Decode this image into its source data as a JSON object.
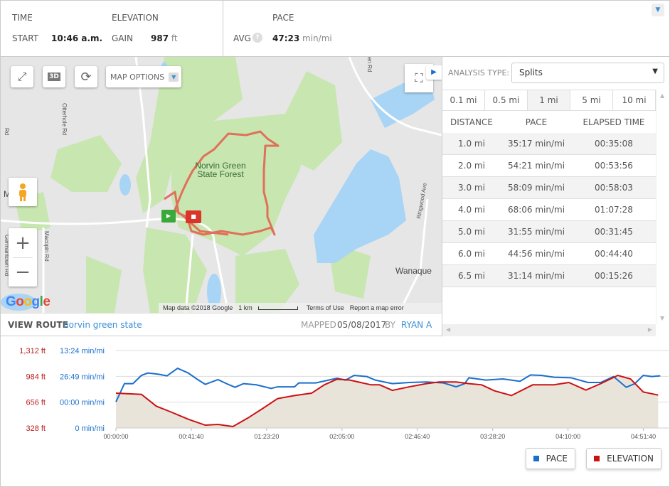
{
  "stats": {
    "time": {
      "heading": "TIME",
      "label": "START",
      "value": "10:46 a.m."
    },
    "elevation": {
      "heading": "ELEVATION",
      "label": "GAIN",
      "value": "987",
      "unit": "ft"
    },
    "pace": {
      "heading": "PACE",
      "label": "AVG",
      "help": "?",
      "value": "47:23",
      "unit": "min/mi"
    }
  },
  "map": {
    "options_label": "MAP OPTIONS",
    "btn_3d": "3D",
    "place_labels": {
      "forest_line1": "Norvin Green",
      "forest_line2": "State Forest",
      "town": "Wanaque",
      "town_left": "M       n"
    },
    "road_labels": {
      "otterhole": "Otterhole Rd",
      "macopin": "Macopin Rd",
      "ringwood": "Ringwood Ave",
      "germantown": "Germantown Rd",
      "top": "en Rd",
      "left": "Rd"
    },
    "logo": "Google",
    "attribution": "Map data ©2018 Google",
    "scale": "1 km",
    "terms": "Terms of Use",
    "report": "Report a map error",
    "colors": {
      "route": "#e0705a",
      "park": "#c8e6b0",
      "water": "#a8d4f5",
      "land": "#e8e8e8"
    }
  },
  "route": {
    "view_label": "VIEW ROUTE",
    "name": "norvin green state",
    "mapped_label": "MAPPED",
    "date": "05/08/2017",
    "by_label": "BY",
    "author": "RYAN A"
  },
  "analysis": {
    "type_label": "ANALYSIS TYPE:",
    "selected": "Splits",
    "tabs": [
      "0.1 mi",
      "0.5 mi",
      "1 mi",
      "5 mi",
      "10 mi"
    ],
    "active_tab": "1 mi",
    "columns": [
      "DISTANCE",
      "PACE",
      "ELAPSED TIME"
    ],
    "rows": [
      [
        "1.0 mi",
        "35:17 min/mi",
        "00:35:08"
      ],
      [
        "2.0 mi",
        "54:21 min/mi",
        "00:53:56"
      ],
      [
        "3.0 mi",
        "58:09 min/mi",
        "00:58:03"
      ],
      [
        "4.0 mi",
        "68:06 min/mi",
        "01:07:28"
      ],
      [
        "5.0 mi",
        "31:55 min/mi",
        "00:31:45"
      ],
      [
        "6.0 mi",
        "44:56 min/mi",
        "00:44:40"
      ],
      [
        "6.5 mi",
        "31:14 min/mi",
        "00:15:26"
      ]
    ]
  },
  "chart_data": {
    "type": "line",
    "x_unit": "elapsed seconds",
    "x_ticks": [
      "00:00:00",
      "00:41:40",
      "01:23:20",
      "02:05:00",
      "02:46:40",
      "03:28:20",
      "04:10:00",
      "04:51:40"
    ],
    "x_tick_values": [
      0,
      2500,
      5000,
      7500,
      10000,
      12500,
      15000,
      17500
    ],
    "xlim": [
      0,
      18100
    ],
    "y_left_elev_ticks": [
      "1,312 ft",
      "984 ft",
      "656 ft",
      "328 ft"
    ],
    "y_left_elev_values": [
      1312,
      984,
      656,
      328
    ],
    "y_pace_ticks": [
      "13:24 min/mi",
      "26:49 min/mi",
      "00:00 min/mi",
      "0 min/mi"
    ],
    "ylim": [
      328,
      1312
    ],
    "grid": true,
    "legend": [
      "PACE",
      "ELEVATION"
    ],
    "legend_placement": "bottom-right",
    "series": [
      {
        "name": "ELEVATION",
        "color": "#cc1111",
        "fill": "#e8e4da",
        "unit": "ft",
        "points": [
          [
            0,
            770
          ],
          [
            847,
            755
          ],
          [
            1340,
            605
          ],
          [
            1834,
            530
          ],
          [
            2399,
            439
          ],
          [
            2963,
            364
          ],
          [
            3386,
            373
          ],
          [
            3880,
            346
          ],
          [
            4374,
            454
          ],
          [
            4868,
            575
          ],
          [
            5362,
            701
          ],
          [
            5926,
            740
          ],
          [
            6491,
            770
          ],
          [
            6914,
            876
          ],
          [
            7337,
            948
          ],
          [
            7761,
            936
          ],
          [
            8466,
            876
          ],
          [
            8748,
            876
          ],
          [
            9172,
            806
          ],
          [
            9736,
            851
          ],
          [
            10300,
            891
          ],
          [
            10724,
            912
          ],
          [
            11288,
            912
          ],
          [
            11712,
            891
          ],
          [
            12135,
            876
          ],
          [
            12558,
            800
          ],
          [
            13123,
            740
          ],
          [
            13828,
            876
          ],
          [
            14533,
            876
          ],
          [
            15027,
            906
          ],
          [
            15592,
            809
          ],
          [
            16085,
            891
          ],
          [
            16650,
            996
          ],
          [
            17073,
            951
          ],
          [
            17496,
            785
          ],
          [
            17990,
            746
          ]
        ]
      },
      {
        "name": "PACE",
        "color": "#1a6fcc",
        "unit": "plotted on shared gridlines (ft scale)",
        "points": [
          [
            0,
            659
          ],
          [
            282,
            891
          ],
          [
            564,
            891
          ],
          [
            847,
            996
          ],
          [
            1058,
            1026
          ],
          [
            1411,
            1011
          ],
          [
            1693,
            990
          ],
          [
            2046,
            1086
          ],
          [
            2399,
            1026
          ],
          [
            2681,
            951
          ],
          [
            2963,
            882
          ],
          [
            3386,
            942
          ],
          [
            3669,
            891
          ],
          [
            3951,
            845
          ],
          [
            4233,
            891
          ],
          [
            4656,
            876
          ],
          [
            5150,
            830
          ],
          [
            5362,
            851
          ],
          [
            5926,
            851
          ],
          [
            6067,
            900
          ],
          [
            6632,
            900
          ],
          [
            7055,
            936
          ],
          [
            7337,
            960
          ],
          [
            7619,
            936
          ],
          [
            7902,
            996
          ],
          [
            8325,
            981
          ],
          [
            8607,
            936
          ],
          [
            9172,
            891
          ],
          [
            9736,
            906
          ],
          [
            10300,
            912
          ],
          [
            10865,
            900
          ],
          [
            11288,
            851
          ],
          [
            11570,
            891
          ],
          [
            11711,
            966
          ],
          [
            12276,
            936
          ],
          [
            12840,
            951
          ],
          [
            13405,
            921
          ],
          [
            13757,
            1002
          ],
          [
            14110,
            996
          ],
          [
            14533,
            972
          ],
          [
            15098,
            966
          ],
          [
            15662,
            906
          ],
          [
            16085,
            906
          ],
          [
            16509,
            981
          ],
          [
            16932,
            845
          ],
          [
            17214,
            891
          ],
          [
            17496,
            996
          ],
          [
            17779,
            981
          ],
          [
            18061,
            990
          ]
        ]
      }
    ]
  }
}
